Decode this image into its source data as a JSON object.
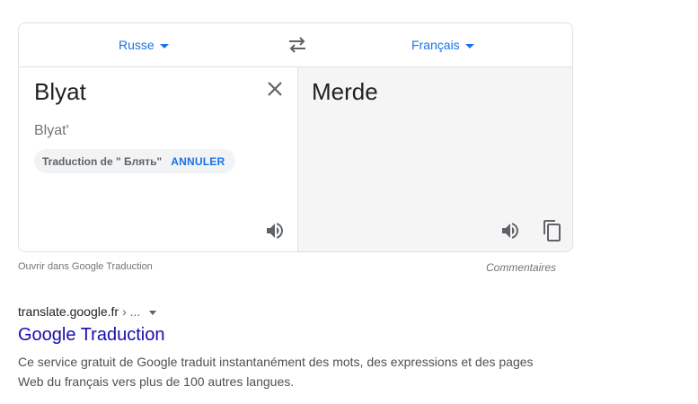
{
  "translator": {
    "source_lang": "Russe",
    "target_lang": "Français",
    "source_text": "Blyat",
    "transliteration": "Blyat'",
    "suggestion": {
      "prefix": "Traduction de \" ",
      "word": "Блять",
      "suffix": "\"",
      "undo_label": "ANNULER"
    },
    "target_text": "Merde",
    "open_link": "Ouvrir dans Google Traduction",
    "feedback": "Commentaires"
  },
  "result": {
    "breadcrumb_site": "translate.google.fr",
    "breadcrumb_sep": "› ...",
    "title": "Google Traduction",
    "snippet_line1": "Ce service gratuit de Google traduit instantanément des mots, des expressions et des pages",
    "snippet_line2": "Web du français vers plus de 100 autres langues."
  },
  "colors": {
    "link_blue": "#1a73e8",
    "result_title": "#1a0dab",
    "icon_gray": "#5f6368"
  }
}
